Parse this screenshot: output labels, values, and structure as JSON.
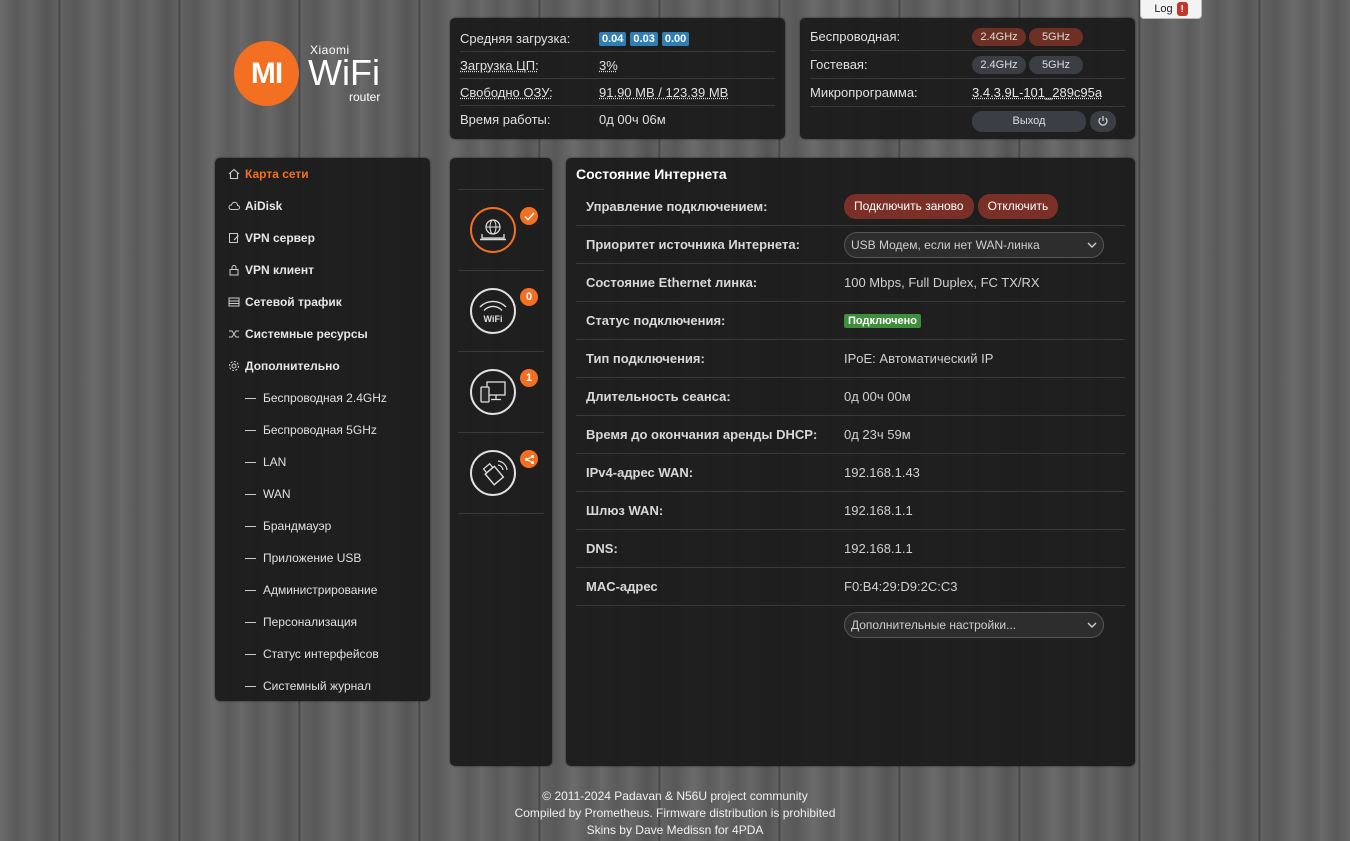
{
  "topbar": {
    "log_label": "Log",
    "log_badge": "!"
  },
  "logo": {
    "mark": "MI",
    "brand": "Xiaomi",
    "product": "WiFi",
    "sub": "router"
  },
  "status": {
    "load_label": "Средняя загрузка:",
    "load_values": [
      "0.04",
      "0.03",
      "0.00"
    ],
    "cpu_label": "Загрузка ЦП:",
    "cpu_value": "3%",
    "ram_label": "Свободно ОЗУ:",
    "ram_value": "91.90 MB / 123.39 MB",
    "uptime_label": "Время работы:",
    "uptime_value": "0д 00ч 06м"
  },
  "wireless": {
    "wireless_label": "Беспроводная:",
    "guest_label": "Гостевая:",
    "band_24": "2.4GHz",
    "band_5": "5GHz",
    "firmware_label": "Микропрограмма:",
    "firmware_value": "3.4.3.9L-101_289c95a",
    "logout_label": "Выход"
  },
  "sidebar": {
    "items": [
      {
        "label": "Карта сети",
        "icon": "home-icon"
      },
      {
        "label": "AiDisk",
        "icon": "cloud-icon"
      },
      {
        "label": "VPN сервер",
        "icon": "vpn-server-icon"
      },
      {
        "label": "VPN клиент",
        "icon": "lock-icon"
      },
      {
        "label": "Сетевой трафик",
        "icon": "traffic-icon"
      },
      {
        "label": "Системные ресурсы",
        "icon": "shuffle-icon"
      },
      {
        "label": "Дополнительно",
        "icon": "gear-icon"
      }
    ],
    "subitems": [
      "Беспроводная 2.4GHz",
      "Беспроводная 5GHz",
      "LAN",
      "WAN",
      "Брандмауэр",
      "Приложение USB",
      "Администрирование",
      "Персонализация",
      "Статус интерфейсов",
      "Системный журнал"
    ]
  },
  "icons": {
    "wifi_text": "WiFi",
    "wifi_badge": "0",
    "clients_badge": "1"
  },
  "internet": {
    "title": "Состояние Интернета",
    "rows": [
      {
        "label": "Управление подключением:"
      },
      {
        "label": "Приоритет источника Интернета:",
        "value": "USB Модем, если нет WAN-линка"
      },
      {
        "label": "Состояние Ethernet линка:",
        "value": "100 Mbps, Full Duplex, FC TX/RX"
      },
      {
        "label": "Статус подключения:",
        "value": "Подключено"
      },
      {
        "label": "Тип подключения:",
        "value": "IPoE: Автоматический IP"
      },
      {
        "label": "Длительность сеанса:",
        "value": "0д 00ч 00м"
      },
      {
        "label": "Время до окончания аренды DHCP:",
        "value": "0д 23ч 59м"
      },
      {
        "label": "IPv4-адрес WAN:",
        "value": "192.168.1.43"
      },
      {
        "label": "Шлюз WAN:",
        "value": "192.168.1.1"
      },
      {
        "label": "DNS:",
        "value": "192.168.1.1"
      },
      {
        "label": "MAC-адрес",
        "value": "F0:B4:29:D9:2C:C3"
      }
    ],
    "reconnect_label": "Подключить заново",
    "disconnect_label": "Отключить",
    "advanced_select": "Дополнительные настройки..."
  },
  "footer": {
    "line1": "© 2011-2024 Padavan & N56U project community",
    "line2": "Compiled by Prometheus. Firmware distribution is prohibited",
    "line3": "Skins by Dave Medissn for 4PDA"
  },
  "colors": {
    "accent": "#f36f21",
    "danger": "#7a3026",
    "info": "#2f7fb4",
    "success": "#3e8e3c"
  }
}
